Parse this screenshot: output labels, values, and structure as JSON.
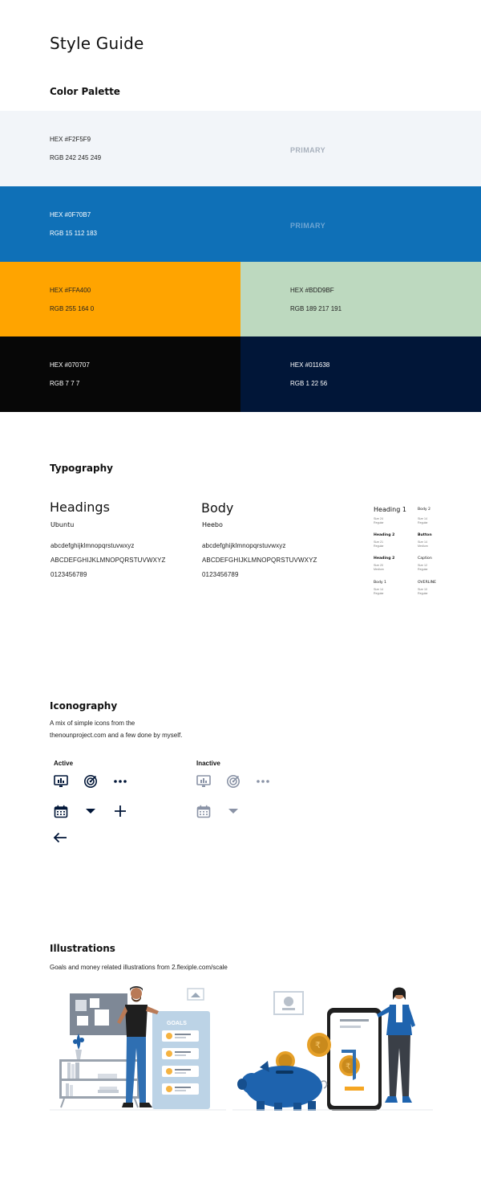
{
  "page": {
    "title": "Style Guide"
  },
  "palette": {
    "heading": "Color Palette",
    "swatches": [
      {
        "hex": "HEX #F2F5F9",
        "rgb": "RGB 242 245 249",
        "tag": "PRIMARY",
        "color": "#F2F5F9",
        "text_color": "#222222",
        "tag_color": "#A7B0BC"
      },
      {
        "hex": "HEX #0F70B7",
        "rgb": "RGB 15 112 183",
        "tag": "PRIMARY",
        "color": "#0F70B7",
        "text_color": "#ffffff",
        "tag_color": "#6FA6D3"
      },
      {
        "hex": "HEX #FFA400",
        "rgb": "RGB 255 164 0",
        "color": "#FFA400",
        "text_color": "#222222"
      },
      {
        "hex": "HEX #BDD9BF",
        "rgb": "RGB 189 217 191",
        "color": "#BDD9BF",
        "text_color": "#222222"
      },
      {
        "hex": "HEX #070707",
        "rgb": "RGB 7 7 7",
        "color": "#070707",
        "text_color": "#ffffff"
      },
      {
        "hex": "HEX #011638",
        "rgb": "RGB 1 22 56",
        "color": "#011638",
        "text_color": "#ffffff"
      }
    ]
  },
  "typography": {
    "heading": "Typography",
    "headings_font": {
      "label": "Headings",
      "family": "Ubuntu"
    },
    "body_font": {
      "label": "Body",
      "family": "Heebo"
    },
    "lowercase": "abcdefghijklmnopqrstuvwxyz",
    "uppercase": "ABCDEFGHIJKLMNOPQRSTUVWXYZ",
    "digits": "0123456789",
    "scale_left": [
      {
        "name": "Heading 1",
        "size": "Size 24",
        "weight": "Regular"
      },
      {
        "name": "Heading 2",
        "size": "Size 21",
        "weight": "Regular"
      },
      {
        "name": "Heading 2",
        "size": "Size 20",
        "weight": "Medium"
      },
      {
        "name": "Body 1",
        "size": "Size 14",
        "weight": "Regular"
      }
    ],
    "scale_right": [
      {
        "name": "Body 2",
        "size": "Size 14",
        "weight": "Regular"
      },
      {
        "name": "Button",
        "size": "Size 14",
        "weight": "Medium"
      },
      {
        "name": "Caption",
        "size": "Size 12",
        "weight": "Regular"
      },
      {
        "name": "OVERLINE",
        "size": "Size 10",
        "weight": "Regular"
      }
    ]
  },
  "iconography": {
    "heading": "Iconography",
    "description_line1": "A mix of simple icons from the",
    "description_line2": "thenounproject.com and a few done by myself.",
    "active_label": "Active",
    "inactive_label": "Inactive",
    "active_color": "#011638",
    "inactive_color": "#8A93A6",
    "icons": [
      "chart-icon",
      "target-icon",
      "more-icon",
      "calendar-icon",
      "caret-down-icon",
      "plus-icon",
      "arrow-left-icon"
    ]
  },
  "illustrations": {
    "heading": "Illustrations",
    "description": "Goals and money related illustrations from 2.flexiple.com/scale",
    "goals_card_title": "GOALS"
  }
}
